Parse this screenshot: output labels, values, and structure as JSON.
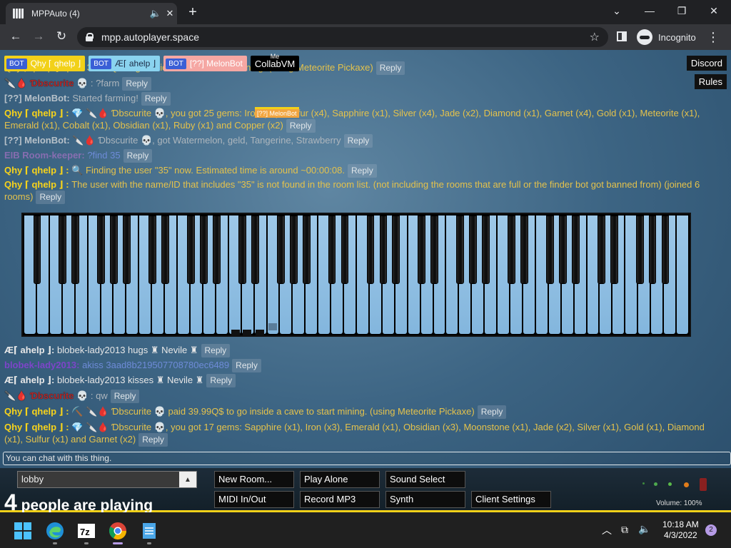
{
  "browser": {
    "tab_title": "MPPAuto (4)",
    "url": "mpp.autoplayer.space",
    "incognito_label": "Incognito"
  },
  "badges": [
    {
      "tag": "BOT",
      "name": "Qhy ⌈ qhelp ⌋"
    },
    {
      "tag": "BOT",
      "name": "Æ⌈ ahelp ⌋"
    },
    {
      "tag": "BOT",
      "name": "[??] MelonBot"
    },
    {
      "tag": "Me",
      "name": "CollabVM"
    }
  ],
  "melon_tag": "[??] MelonBot",
  "side_buttons": {
    "discord": "Discord",
    "rules": "Rules"
  },
  "reply_label": "Reply",
  "chat": [
    {
      "name": "",
      "name_class": "",
      "text": "Qhy ⌈ qhelp ⌋ : paid 39.99Q$ to go inside a cave to start mining. (using Meteorite Pickaxe)",
      "text_class": "t-yellow"
    },
    {
      "name": "🔪🩸 Ɗbscurite",
      "name_class": "n-obs",
      "text": "💀 : ?farm",
      "text_class": "t-grey"
    },
    {
      "name": "[??] MelonBot:",
      "name_class": "n-melon",
      "text": "Started farming!",
      "text_class": "t-grey"
    },
    {
      "name": "Qhy ⌈ qhelp ⌋ :",
      "name_class": "n-qhy",
      "text": "💎 🔪🩸 Ɗbscurite 💀, you got 25 gems: Iron (x1), Sulfur (x4), Sapphire (x1), Silver (x4), Jade (x2), Diamond (x1), Garnet (x4), Gold (x1), Meteorite (x1), Emerald (x1), Cobalt (x1), Obsidian (x1), Ruby (x1) and Copper (x2)",
      "text_class": "t-yellow"
    },
    {
      "name": "[??] MelonBot:",
      "name_class": "n-melon",
      "text": "🔪🩸 Ɗbscurite 💀, got Watermelon, geld, Tangerine, Strawberry",
      "text_class": "t-grey"
    },
    {
      "name": "EIB Room-keeper:",
      "name_class": "n-eib",
      "text": "?find 35",
      "text_class": "t-purple"
    },
    {
      "name": "Qhy ⌈ qhelp ⌋ :",
      "name_class": "n-qhy",
      "text": "🔍 Finding the user \"35\" now. Estimated time is around ~00:00:08.",
      "text_class": "t-yellow"
    },
    {
      "name": "Qhy ⌈ qhelp ⌋ :",
      "name_class": "n-qhy",
      "text": "The user with the name/ID that includes \"35\" is not found in the room list. (not including the rooms that are full or the finder bot got banned from) (joined 6 rooms)",
      "text_class": "t-yellow"
    },
    {
      "name": "Æ⌈ ahelp ⌋:",
      "name_class": "n-ae",
      "text": "blobek-lady2013 hugs ♜ Nevile ♜",
      "text_class": "t-white"
    },
    {
      "name": "blobek-lady2013:",
      "name_class": "n-blob",
      "text": "akiss 3aad8b219507708780ec6489",
      "text_class": "t-purple"
    },
    {
      "name": "Æ⌈ ahelp ⌋:",
      "name_class": "n-ae",
      "text": "blobek-lady2013 kisses ♜ Nevile ♜",
      "text_class": "t-white"
    },
    {
      "name": "🔪🩸 Ɗbscurite",
      "name_class": "n-obs",
      "text": "💀 : qw",
      "text_class": "t-grey"
    },
    {
      "name": "Qhy ⌈ qhelp ⌋ :",
      "name_class": "n-qhy",
      "text": "⛏️ 🔪🩸 Ɗbscurite 💀 paid 39.99Q$ to go inside a cave to start mining. (using Meteorite Pickaxe)",
      "text_class": "t-yellow"
    },
    {
      "name": "Qhy ⌈ qhelp ⌋ :",
      "name_class": "n-qhy",
      "text": "💎 🔪🩸 Ɗbscurite 💀, you got 17 gems: Sapphire (x1), Iron (x3), Emerald (x1), Obsidian (x3), Moonstone (x1), Jade (x2), Silver (x1), Gold (x1), Diamond (x1), Sulfur (x1) and Garnet (x2)",
      "text_class": "t-yellow"
    }
  ],
  "chat_input_placeholder": "You can chat with this thing.",
  "room": {
    "value": "lobby"
  },
  "players": {
    "count": "4",
    "label": " people are playing"
  },
  "controls": {
    "new_room": "New Room...",
    "play_alone": "Play Alone",
    "sound_select": "Sound Select",
    "midi": "MIDI In/Out",
    "record": "Record MP3",
    "synth": "Synth",
    "client_settings": "Client Settings"
  },
  "volume": {
    "label": "Volume: 100%"
  },
  "taskbar": {
    "time": "10:18 AM",
    "date": "4/3/2022",
    "notifications": "2"
  },
  "colors": {
    "accent": "#f2d119",
    "piano_key": "#90bfe3",
    "bot_badge": "#3a5fd6"
  }
}
